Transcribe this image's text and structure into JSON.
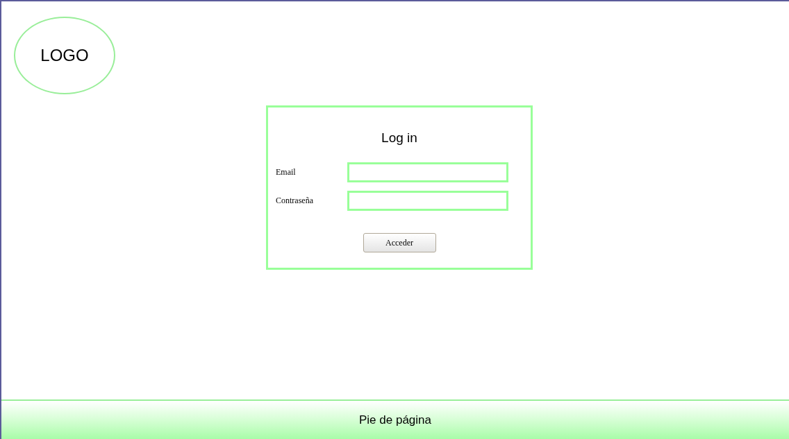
{
  "logo": {
    "text": "LOGO"
  },
  "login": {
    "title": "Log in",
    "fields": [
      {
        "label": "Email"
      },
      {
        "label": "Contraseña"
      }
    ],
    "button": "Acceder"
  },
  "footer": {
    "text": "Pie de página"
  }
}
